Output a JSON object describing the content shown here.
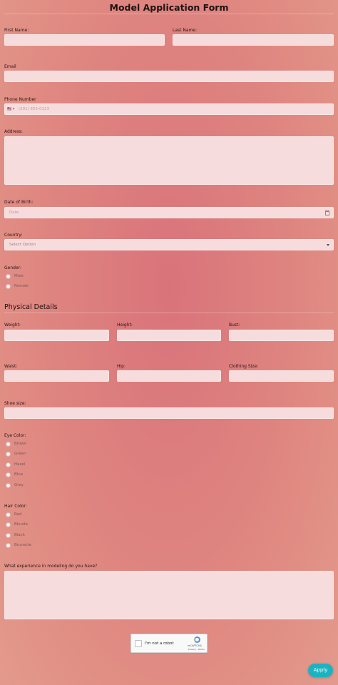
{
  "form": {
    "title": "Model Application Form",
    "first_name_label": "First Name:",
    "last_name_label": "Last Name:",
    "email_label": "Email",
    "phone_label": "Phone Number",
    "phone_flag": "🇺🇸 ▾",
    "phone_placeholder": "(201) 555-0123",
    "address_label": "Address:",
    "dob_label": "Date of Birth:",
    "dob_placeholder": "Date",
    "country_label": "Country:",
    "country_placeholder": "Select Option",
    "gender_label": "Gender:",
    "gender_options": [
      "Male",
      "Female"
    ],
    "physical_section": "Physical Details",
    "weight_label": "Weight:",
    "height_label": "Height:",
    "bust_label": "Bust:",
    "waist_label": "Waist:",
    "hip_label": "Hip:",
    "clothing_label": "Clothing Size:",
    "shoe_label": "Shoe size:",
    "eye_label": "Eye Color:",
    "eye_options": [
      "Brown",
      "Green",
      "Hazel",
      "Blue",
      "Grey"
    ],
    "hair_label": "Hair Color:",
    "hair_options": [
      "Red",
      "Blonde",
      "Black",
      "Brunette"
    ],
    "experience_label": "What experience in modeling do you have?",
    "captcha_text": "I'm not a robot",
    "captcha_brand": "reCAPTCHA",
    "captcha_links": "Privacy - Terms",
    "apply_label": "Apply"
  }
}
